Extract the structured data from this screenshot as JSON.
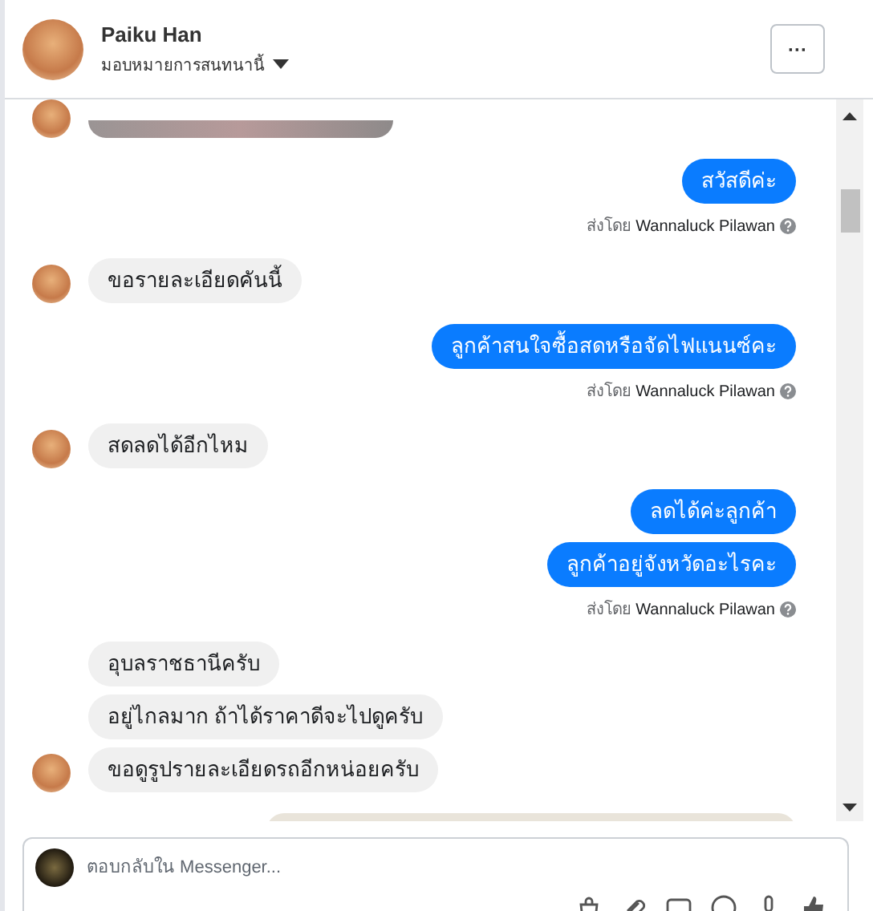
{
  "header": {
    "name": "Paiku Han",
    "subtitle": "มอบหมายการสนทนานี้",
    "more": "···"
  },
  "messages": [
    {
      "kind": "photo_in",
      "avatar": true
    },
    {
      "kind": "outgoing",
      "text": "สวัสดีค่ะ"
    },
    {
      "kind": "sender",
      "label": "ส่งโดย",
      "name": "Wannaluck Pilawan"
    },
    {
      "kind": "incoming",
      "text": "ขอรายละเอียดคันนี้",
      "avatar": true
    },
    {
      "kind": "outgoing",
      "text": "ลูกค้าสนใจซื้อสดหรือจัดไฟแนนซ์คะ"
    },
    {
      "kind": "sender",
      "label": "ส่งโดย",
      "name": "Wannaluck Pilawan"
    },
    {
      "kind": "incoming",
      "text": "สดลดได้อีกไหม",
      "avatar": true
    },
    {
      "kind": "outgoing",
      "text": "ลดได้ค่ะลูกค้า"
    },
    {
      "kind": "outgoing",
      "text": "ลูกค้าอยู่จังหวัดอะไรคะ"
    },
    {
      "kind": "sender",
      "label": "ส่งโดย",
      "name": "Wannaluck Pilawan"
    },
    {
      "kind": "incoming",
      "text": "อุบลราชธานีครับ",
      "avatar": false
    },
    {
      "kind": "incoming",
      "text": "อยู่ไกลมาก ถ้าได้ราคาดีจะไปดูครับ",
      "avatar": false
    },
    {
      "kind": "incoming",
      "text": "ขอดูรูปรายละเอียดรถอีกหน่อยครับ",
      "avatar": true
    },
    {
      "kind": "photo_out"
    }
  ],
  "composer": {
    "placeholder": "ตอบกลับใน Messenger..."
  }
}
